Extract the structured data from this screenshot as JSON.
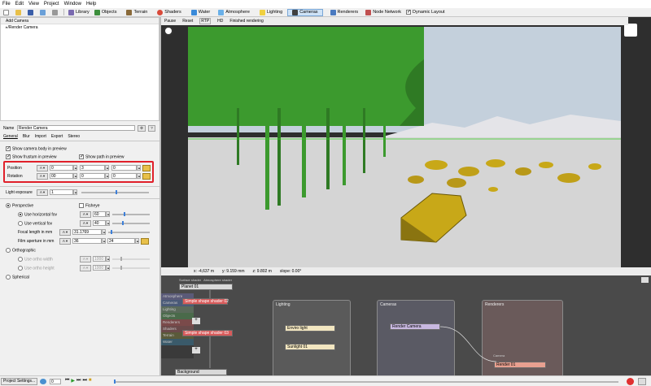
{
  "menu": [
    "File",
    "Edit",
    "View",
    "Project",
    "Window",
    "Help"
  ],
  "toolbar": {
    "library": "Library",
    "objects": "Objects",
    "terrain": "Terrain",
    "shaders": "Shaders",
    "water": "Water",
    "atmosphere": "Atmosphere",
    "lighting": "Lighting",
    "cameras": "Cameras",
    "renderers": "Renderers",
    "node_network": "Node Network",
    "dynamic_layout": "Dynamic Layout"
  },
  "camera_list": {
    "add_camera": "Add Camera",
    "item": "/Render Camera"
  },
  "render_bar": {
    "pause": "Pause",
    "reset": "Reset",
    "rtp": "RTP",
    "hd": "HD",
    "status": "Finished rendering"
  },
  "status": {
    "x": "x: -4,637 m",
    "y": "y: 9.159 mm",
    "z": "z: 9.802 m",
    "slope": "slope: 0.00°"
  },
  "props": {
    "name_label": "Name",
    "name_value": "Render Camera",
    "tabs": [
      "General",
      "Blur",
      "Import",
      "Export",
      "Stereo"
    ],
    "show_body": "Show camera body in preview",
    "show_frustum": "Show frustum in preview",
    "show_path": "Show path in preview",
    "position_label": "Position",
    "rotation_label": "Rotation",
    "position": [
      "0",
      "3",
      "0"
    ],
    "rotation": [
      "00",
      "0",
      "0"
    ],
    "light_exposure_label": "Light exposure",
    "light_exposure": "1",
    "perspective": "Perspective",
    "fisheye": "Fisheye",
    "use_h_fov": "Use horizontal fov",
    "h_fov": "60",
    "use_v_fov": "Use vertical fov",
    "v_fov": "40",
    "focal_label": "Focal length in mm",
    "focal": "31.1769",
    "aperture_label": "Film aperture in mm",
    "aperture_w": "36",
    "aperture_h": "24",
    "orthographic": "Orthographic",
    "ortho_w_label": "Use ortho width",
    "ortho_w": "1000",
    "ortho_h_label": "Use ortho height",
    "ortho_h": "1000",
    "spherical": "Spherical"
  },
  "nodes": {
    "planet_top": "Surface shader",
    "planet_top2": "Atmosphere shader",
    "planet": "Planet 01",
    "shader1": "Simple shape shader 02",
    "shader2": "Simple shape shader 03",
    "categories": [
      "Atmosphere",
      "Cameras",
      "Lighting",
      "Objects",
      "Renderers",
      "Shaders",
      "Terrain",
      "Water"
    ],
    "background": "Background",
    "lighting_title": "Lighting",
    "enviro": "Enviro light",
    "sunlight": "Sunlight 01",
    "cameras_title": "Cameras",
    "render_camera": "Render Camera",
    "renderers_title": "Renderers",
    "camera_port": "Camera",
    "renderer": "Render 01"
  },
  "bottom": {
    "project_settings": "Project Settings...",
    "frame": "0"
  },
  "colors": {
    "highlight": "#e0202a",
    "lighting_group": "#5a5a5a",
    "cameras_group": "#5a5a64",
    "renderers_group": "#6a5a5a",
    "sky": "#c4d0dc",
    "ground": "#d5d5d5"
  }
}
